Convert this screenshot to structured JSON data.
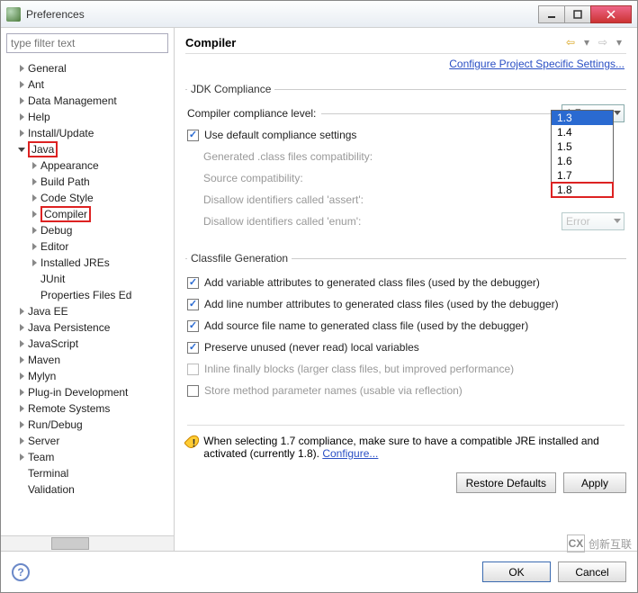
{
  "window": {
    "title": "Preferences"
  },
  "filter": {
    "placeholder": "type filter text"
  },
  "tree": {
    "items": [
      {
        "label": "General",
        "depth": 1,
        "expand": "r"
      },
      {
        "label": "Ant",
        "depth": 1,
        "expand": "r"
      },
      {
        "label": "Data Management",
        "depth": 1,
        "expand": "r"
      },
      {
        "label": "Help",
        "depth": 1,
        "expand": "r"
      },
      {
        "label": "Install/Update",
        "depth": 1,
        "expand": "r"
      },
      {
        "label": "Java",
        "depth": 1,
        "expand": "d",
        "hl": true
      },
      {
        "label": "Appearance",
        "depth": 2,
        "expand": "r"
      },
      {
        "label": "Build Path",
        "depth": 2,
        "expand": "r"
      },
      {
        "label": "Code Style",
        "depth": 2,
        "expand": "r"
      },
      {
        "label": "Compiler",
        "depth": 2,
        "expand": "r",
        "hl": true
      },
      {
        "label": "Debug",
        "depth": 2,
        "expand": "r"
      },
      {
        "label": "Editor",
        "depth": 2,
        "expand": "r"
      },
      {
        "label": "Installed JREs",
        "depth": 2,
        "expand": "r"
      },
      {
        "label": "JUnit",
        "depth": 2,
        "expand": ""
      },
      {
        "label": "Properties Files Ed",
        "depth": 2,
        "expand": ""
      },
      {
        "label": "Java EE",
        "depth": 1,
        "expand": "r"
      },
      {
        "label": "Java Persistence",
        "depth": 1,
        "expand": "r"
      },
      {
        "label": "JavaScript",
        "depth": 1,
        "expand": "r"
      },
      {
        "label": "Maven",
        "depth": 1,
        "expand": "r"
      },
      {
        "label": "Mylyn",
        "depth": 1,
        "expand": "r"
      },
      {
        "label": "Plug-in Development",
        "depth": 1,
        "expand": "r"
      },
      {
        "label": "Remote Systems",
        "depth": 1,
        "expand": "r"
      },
      {
        "label": "Run/Debug",
        "depth": 1,
        "expand": "r"
      },
      {
        "label": "Server",
        "depth": 1,
        "expand": "r"
      },
      {
        "label": "Team",
        "depth": 1,
        "expand": "r"
      },
      {
        "label": "Terminal",
        "depth": 1,
        "expand": ""
      },
      {
        "label": "Validation",
        "depth": 1,
        "expand": ""
      }
    ]
  },
  "page": {
    "title": "Compiler",
    "config_link": "Configure Project Specific Settings..."
  },
  "jdk": {
    "legend": "JDK Compliance",
    "compliance_label": "Compiler compliance level:",
    "compliance_value": "1.7",
    "compliance_options": [
      "1.3",
      "1.4",
      "1.5",
      "1.6",
      "1.7",
      "1.8"
    ],
    "use_default_label": "Use default compliance settings",
    "generated_label": "Generated .class files compatibility:",
    "source_label": "Source compatibility:",
    "assert_label": "Disallow identifiers called 'assert':",
    "enum_label": "Disallow identifiers called 'enum':",
    "enum_value": "Error"
  },
  "classfile": {
    "legend": "Classfile Generation",
    "c1": "Add variable attributes to generated class files (used by the debugger)",
    "c2": "Add line number attributes to generated class files (used by the debugger)",
    "c3": "Add source file name to generated class file (used by the debugger)",
    "c4": "Preserve unused (never read) local variables",
    "c5": "Inline finally blocks (larger class files, but improved performance)",
    "c6": "Store method parameter names (usable via reflection)"
  },
  "warning": {
    "text_a": "When selecting 1.7 compliance, make sure to have a compatible JRE installed and activated (currently 1.8). ",
    "link": "Configure..."
  },
  "buttons": {
    "restore": "Restore Defaults",
    "apply": "Apply",
    "ok": "OK",
    "cancel": "Cancel"
  },
  "watermark": {
    "brand": "创新互联",
    "logo": "CX"
  }
}
